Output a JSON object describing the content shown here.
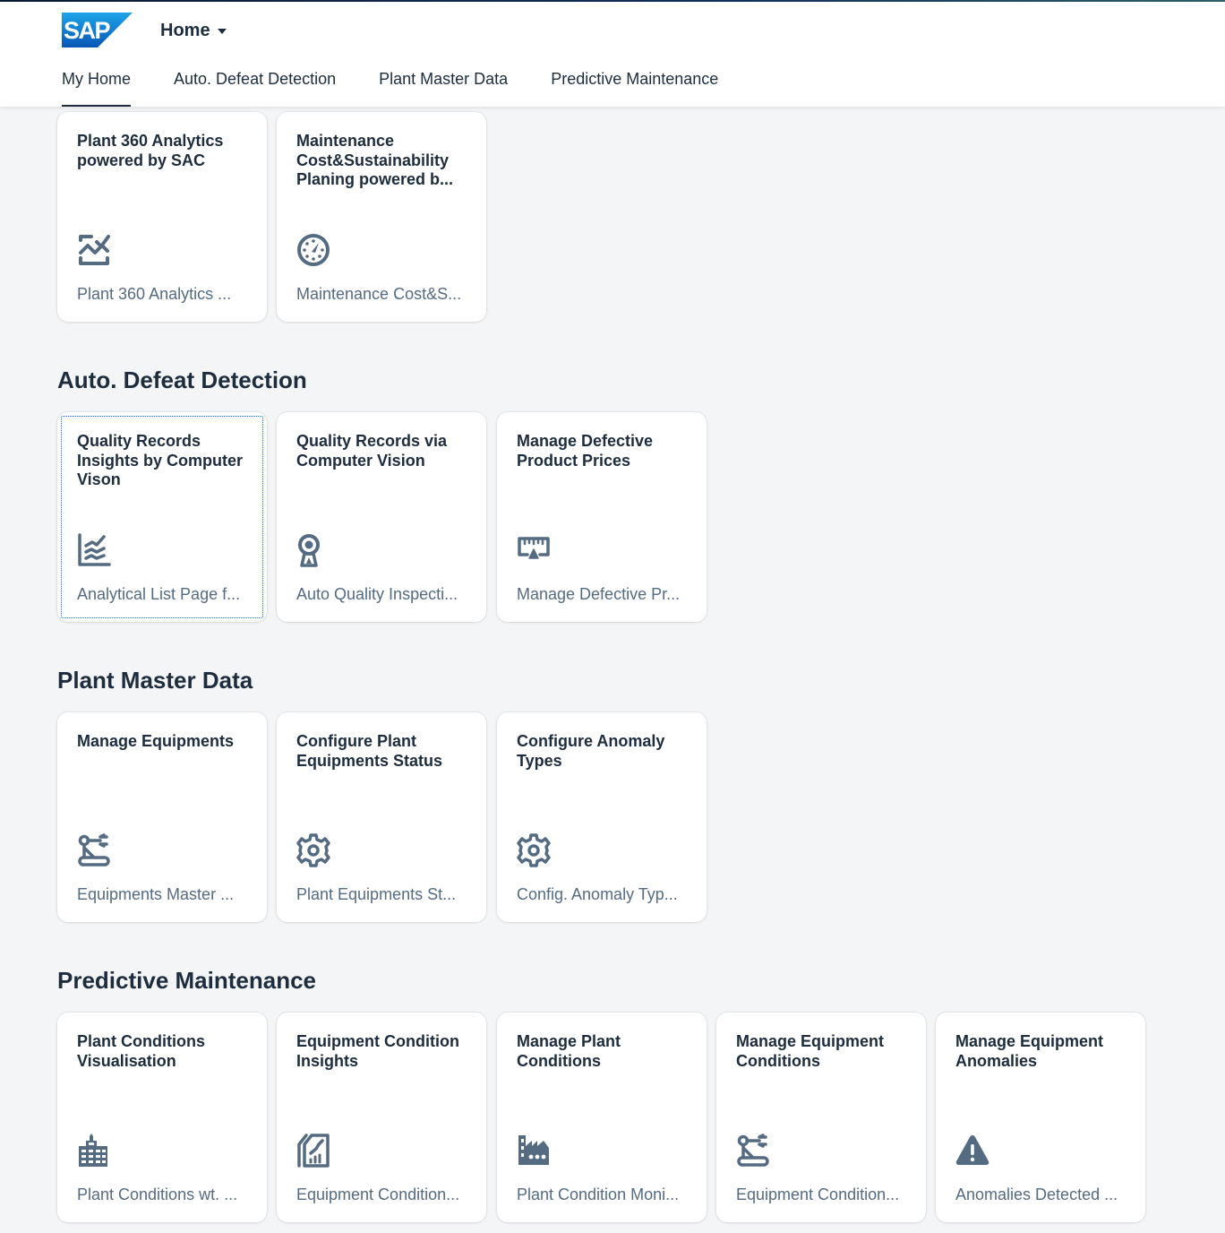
{
  "shell": {
    "logo_text": "SAP",
    "home_menu_label": "Home",
    "accent_color": "#0070f2",
    "text_color": "#1d2d3e",
    "subtitle_color": "#556b82",
    "icon_color": "#556b82"
  },
  "tabs": [
    {
      "label": "My Home",
      "active": true
    },
    {
      "label": "Auto. Defeat Detection",
      "active": false
    },
    {
      "label": "Plant Master Data",
      "active": false
    },
    {
      "label": "Predictive Maintenance",
      "active": false
    }
  ],
  "sections": [
    {
      "title": "",
      "tiles": [
        {
          "title": "Plant 360 Analytics powered by SAC",
          "subtitle": "Plant 360 Analytics ...",
          "icon": "line-chart-check-icon"
        },
        {
          "title": "Maintenance Cost&Sustainability Planing powered b...",
          "subtitle": "Maintenance Cost&S...",
          "icon": "gauge-icon"
        }
      ]
    },
    {
      "title": "Auto. Defeat Detection",
      "tiles": [
        {
          "title": "Quality Records Insights by Computer Vison",
          "subtitle": "Analytical List Page f...",
          "icon": "multi-line-chart-icon",
          "focused": true
        },
        {
          "title": "Quality Records via Computer Vision",
          "subtitle": "Auto Quality Inspecti...",
          "icon": "webcam-icon"
        },
        {
          "title": "Manage Defective Product Prices",
          "subtitle": "Manage Defective Pr...",
          "icon": "measure-icon"
        }
      ]
    },
    {
      "title": "Plant Master Data",
      "tiles": [
        {
          "title": "Manage Equipments",
          "subtitle": "Equipments Master ...",
          "icon": "robot-arm-icon"
        },
        {
          "title": "Configure Plant Equipments Status",
          "subtitle": "Plant Equipments St...",
          "icon": "gear-icon"
        },
        {
          "title": "Configure Anomaly Types",
          "subtitle": "Config. Anomaly Typ...",
          "icon": "gear-icon"
        }
      ]
    },
    {
      "title": "Predictive Maintenance",
      "tiles": [
        {
          "title": "Plant Conditions Visualisation",
          "subtitle": "Plant Conditions wt. ...",
          "icon": "building-icon"
        },
        {
          "title": "Equipment Condition Insights",
          "subtitle": "Equipment Condition...",
          "icon": "document-chart-icon"
        },
        {
          "title": "Manage Plant Conditions",
          "subtitle": "Plant Condition Moni...",
          "icon": "factory-icon"
        },
        {
          "title": "Manage Equipment Conditions",
          "subtitle": "Equipment Condition...",
          "icon": "robot-arm-icon"
        },
        {
          "title": "Manage Equipment Anomalies",
          "subtitle": "Anomalies Detected ...",
          "icon": "warning-icon"
        }
      ]
    }
  ]
}
